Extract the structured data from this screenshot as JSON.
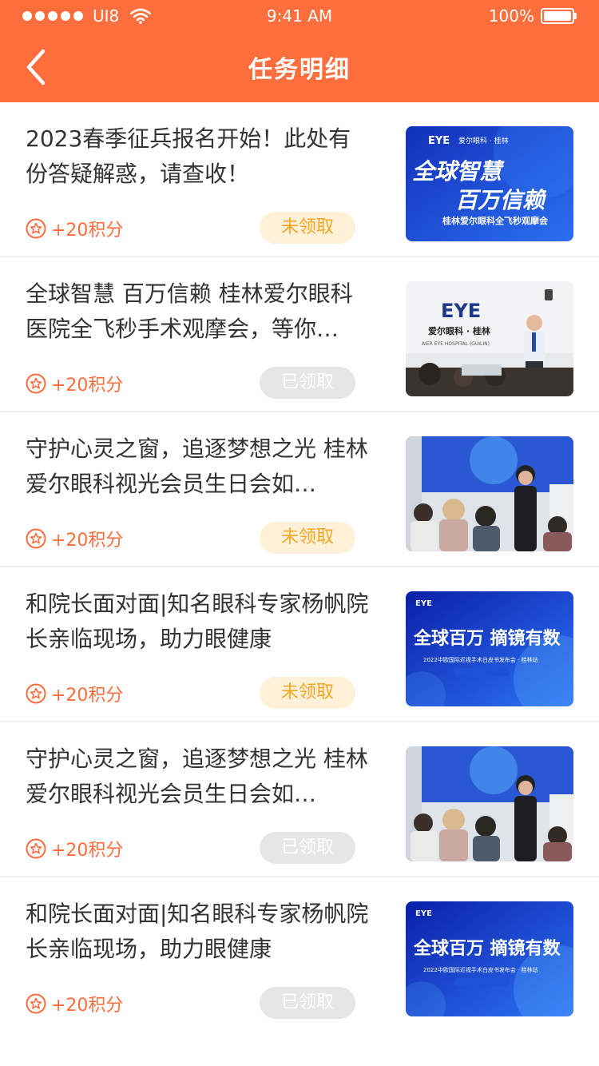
{
  "statusbar": {
    "carrier": "UI8",
    "time": "9:41 AM",
    "battery": "100%"
  },
  "navbar": {
    "title": "任务明细"
  },
  "colors": {
    "accent": "#fe6d3c",
    "unclaimed_bg": "#fff1d9",
    "unclaimed_text": "#f5a623",
    "claimed_bg": "#e6e6e6"
  },
  "items": [
    {
      "title": "2023春季征兵报名开始！此处有份答疑解惑，请查收！",
      "points": "+20积分",
      "status": "未领取",
      "state": "unclaimed",
      "thumb": "banner-a"
    },
    {
      "title": "全球智慧 百万信赖 桂林爱尔眼科医院全飞秒手术观摩会，等你…",
      "points": "+20积分",
      "status": "已领取",
      "state": "claimed",
      "thumb": "photo-lecture"
    },
    {
      "title": "守护心灵之窗，追逐梦想之光 桂林爱尔眼科视光会员生日会如…",
      "points": "+20积分",
      "status": "未领取",
      "state": "unclaimed",
      "thumb": "photo-event"
    },
    {
      "title": "和院长面对面|知名眼科专家杨帆院长亲临现场，助力眼健康",
      "points": "+20积分",
      "status": "未领取",
      "state": "unclaimed",
      "thumb": "banner-b"
    },
    {
      "title": "守护心灵之窗，追逐梦想之光 桂林爱尔眼科视光会员生日会如…",
      "points": "+20积分",
      "status": "已领取",
      "state": "claimed",
      "thumb": "photo-event"
    },
    {
      "title": "和院长面对面|知名眼科专家杨帆院长亲临现场，助力眼健康",
      "points": "+20积分",
      "status": "已领取",
      "state": "claimed",
      "thumb": "banner-b"
    }
  ],
  "thumbs": {
    "banner-a": {
      "brand": "EYE",
      "brand_cn": "爱尔眼科 · 桂林",
      "line1": "全球智慧",
      "line2": "百万信赖",
      "line3": "桂林爱尔眼科全飞秒观摩会"
    },
    "banner-b": {
      "brand": "EYE",
      "line1": "全球百万 摘镜有数",
      "line2": "2022中欧国际近视手术白皮书发布会 · 桂林站"
    },
    "photo-lecture": {
      "brand": "EYE",
      "brand_cn": "爱尔眼科 · 桂林",
      "brand_en": "AIER EYE HOSPITAL (GUILIN)"
    }
  }
}
